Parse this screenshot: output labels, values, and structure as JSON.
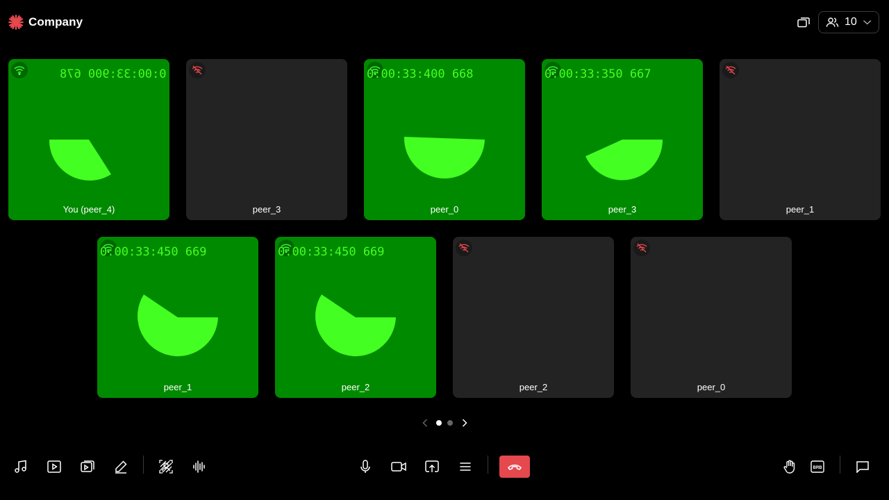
{
  "header": {
    "brand": "Company",
    "peer_count": "10"
  },
  "colors": {
    "video_bg": "#008a00",
    "empty_bg": "#232323",
    "shape": "#44ff22",
    "leave": "#e5484d",
    "offline": "#e5484d"
  },
  "tiles": [
    {
      "name": "You (peer_4)",
      "video": true,
      "timestamp": "0:00:33:900 678",
      "mirrored": true,
      "network": "good"
    },
    {
      "name": "peer_3",
      "video": false,
      "network": "offline"
    },
    {
      "name": "peer_0",
      "video": true,
      "timestamp": "0:00:33:400 668",
      "mirrored": false,
      "network": "good"
    },
    {
      "name": "peer_3",
      "video": true,
      "timestamp": "0:00:33:350 667",
      "mirrored": false,
      "network": "good"
    },
    {
      "name": "peer_1",
      "video": false,
      "network": "offline"
    },
    {
      "name": "peer_1",
      "video": true,
      "timestamp": "0:00:33:450 669",
      "mirrored": false,
      "network": "good"
    },
    {
      "name": "peer_2",
      "video": true,
      "timestamp": "0:00:33:450 669",
      "mirrored": false,
      "network": "good"
    },
    {
      "name": "peer_2",
      "video": false,
      "network": "offline"
    },
    {
      "name": "peer_0",
      "video": false,
      "network": "offline"
    }
  ],
  "pagination": {
    "current_page": 1,
    "total_pages": 2
  },
  "toolbar": {
    "left": [
      "music-icon",
      "video-playlist-icon",
      "screen-capture-icon",
      "whiteboard-pencil-icon",
      "virtual-background-icon",
      "audio-waveform-icon"
    ],
    "center": [
      "microphone-icon",
      "camera-icon",
      "share-screen-icon",
      "more-menu-icon",
      "leave-call-icon"
    ],
    "right": [
      "raise-hand-icon",
      "brb-icon",
      "chat-icon"
    ]
  }
}
